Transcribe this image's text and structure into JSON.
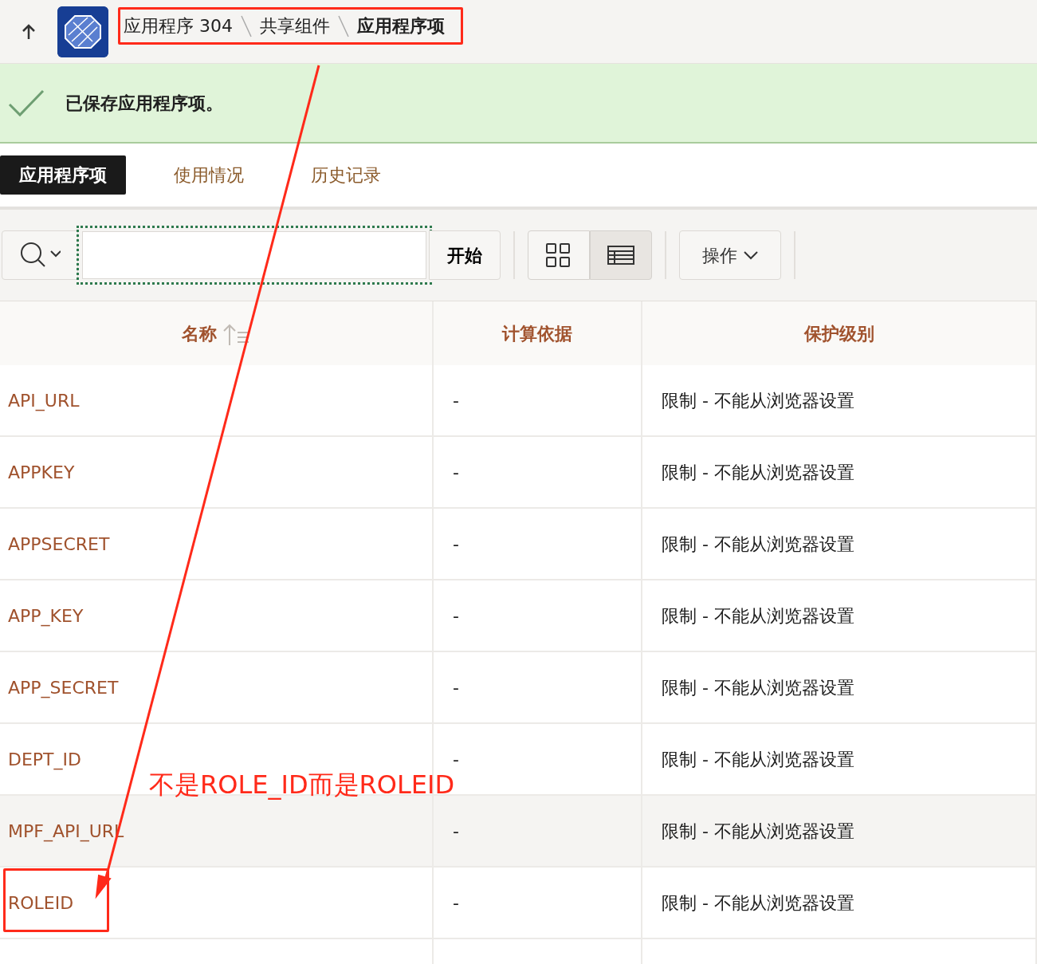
{
  "breadcrumb": [
    {
      "label": "应用程序 304",
      "current": false
    },
    {
      "label": "共享组件",
      "current": false
    },
    {
      "label": "应用程序项",
      "current": true
    }
  ],
  "alert": {
    "message": "已保存应用程序项。"
  },
  "tabs": [
    {
      "label": "应用程序项",
      "selected": true
    },
    {
      "label": "使用情况",
      "selected": false
    },
    {
      "label": "历史记录",
      "selected": false
    }
  ],
  "toolbar": {
    "go_button": "开始",
    "actions_button": "操作",
    "views": [
      {
        "kind": "icons",
        "selected": false
      },
      {
        "kind": "report",
        "selected": true
      }
    ]
  },
  "table": {
    "columns": [
      {
        "label": "名称",
        "sorted": true
      },
      {
        "label": "计算依据",
        "sorted": false
      },
      {
        "label": "保护级别",
        "sorted": false
      }
    ],
    "rows": [
      {
        "name": "API_URL",
        "computed": "-",
        "protection": "限制 - 不能从浏览器设置",
        "highlighted": false
      },
      {
        "name": "APPKEY",
        "computed": "-",
        "protection": "限制 - 不能从浏览器设置",
        "highlighted": false
      },
      {
        "name": "APPSECRET",
        "computed": "-",
        "protection": "限制 - 不能从浏览器设置",
        "highlighted": false
      },
      {
        "name": "APP_KEY",
        "computed": "-",
        "protection": "限制 - 不能从浏览器设置",
        "highlighted": false
      },
      {
        "name": "APP_SECRET",
        "computed": "-",
        "protection": "限制 - 不能从浏览器设置",
        "highlighted": false
      },
      {
        "name": "DEPT_ID",
        "computed": "-",
        "protection": "限制 - 不能从浏览器设置",
        "highlighted": false
      },
      {
        "name": "MPF_API_URL",
        "computed": "-",
        "protection": "限制 - 不能从浏览器设置",
        "highlighted": true
      },
      {
        "name": "ROLEID",
        "computed": "-",
        "protection": "限制 - 不能从浏览器设置",
        "highlighted": false
      }
    ]
  },
  "annotation": {
    "note": "不是ROLE_ID而是ROLEID"
  }
}
